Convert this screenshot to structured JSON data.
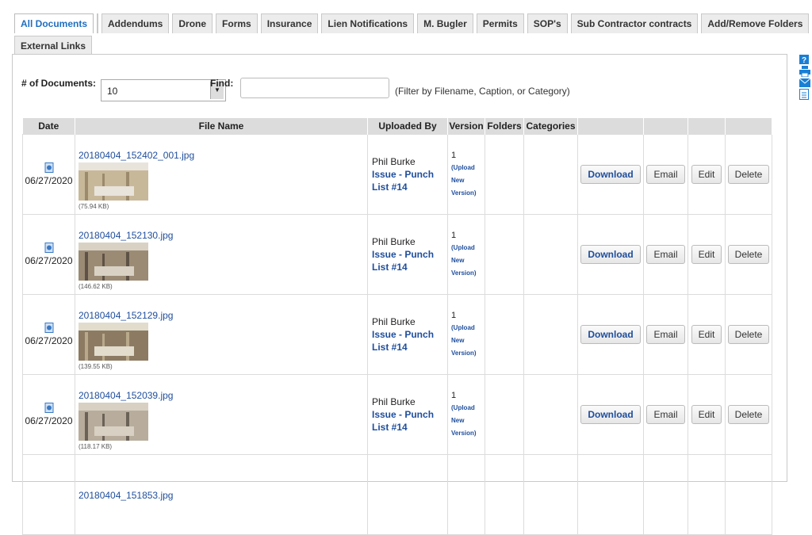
{
  "tabs_row1": [
    {
      "label": "All Documents",
      "active": true
    },
    {
      "label": "",
      "active": false
    },
    {
      "label": "Addendums",
      "active": false
    },
    {
      "label": "Drone",
      "active": false
    },
    {
      "label": "Forms",
      "active": false
    },
    {
      "label": "Insurance",
      "active": false
    },
    {
      "label": "Lien Notifications",
      "active": false
    },
    {
      "label": "M. Bugler",
      "active": false
    },
    {
      "label": "Permits",
      "active": false
    },
    {
      "label": "SOP's",
      "active": false
    },
    {
      "label": "Sub Contractor contracts",
      "active": false
    },
    {
      "label": "Add/Remove Folders",
      "active": false
    }
  ],
  "tabs_row2": [
    {
      "label": "External Links",
      "active": false
    }
  ],
  "controls": {
    "doc_count_label": "# of Documents:",
    "doc_count_value": "10",
    "find_label": "Find:",
    "find_value": "",
    "find_hint": "(Filter by Filename, Caption, or Category)"
  },
  "table": {
    "headers": {
      "date": "Date",
      "file_name": "File Name",
      "uploaded_by": "Uploaded By",
      "version": "Version",
      "folders": "Folders",
      "categories": "Categories"
    },
    "rows": [
      {
        "date": "06/27/2020",
        "file": "20180404_152402_001.jpg",
        "size": "(75.94 KB)",
        "uploader": "Phil Burke",
        "issue": "Issue - Punch List #14",
        "version": "1",
        "upload_line1": "(Upload",
        "upload_line2": "New",
        "upload_line3": "Version)"
      },
      {
        "date": "06/27/2020",
        "file": "20180404_152130.jpg",
        "size": "(146.62 KB)",
        "uploader": "Phil Burke",
        "issue": "Issue - Punch List #14",
        "version": "1",
        "upload_line1": "(Upload",
        "upload_line2": "New",
        "upload_line3": "Version)"
      },
      {
        "date": "06/27/2020",
        "file": "20180404_152129.jpg",
        "size": "(139.55 KB)",
        "uploader": "Phil Burke",
        "issue": "Issue - Punch List #14",
        "version": "1",
        "upload_line1": "(Upload",
        "upload_line2": "New",
        "upload_line3": "Version)"
      },
      {
        "date": "06/27/2020",
        "file": "20180404_152039.jpg",
        "size": "(118.17 KB)",
        "uploader": "Phil Burke",
        "issue": "Issue - Punch List #14",
        "version": "1",
        "upload_line1": "(Upload",
        "upload_line2": "New",
        "upload_line3": "Version)"
      },
      {
        "date": "",
        "file": "20180404_151853.jpg",
        "size": "",
        "uploader": "",
        "issue": "",
        "version": "",
        "upload_line1": "",
        "upload_line2": "",
        "upload_line3": ""
      }
    ],
    "buttons": {
      "download": "Download",
      "email": "Email",
      "edit": "Edit",
      "delete": "Delete"
    }
  },
  "side_icons": [
    "help-icon",
    "print-icon",
    "mail-icon",
    "document-icon"
  ],
  "colors": {
    "link": "#1f4e9c",
    "active_tab": "#1f6fc0",
    "header_bg": "#dcdcdc"
  }
}
